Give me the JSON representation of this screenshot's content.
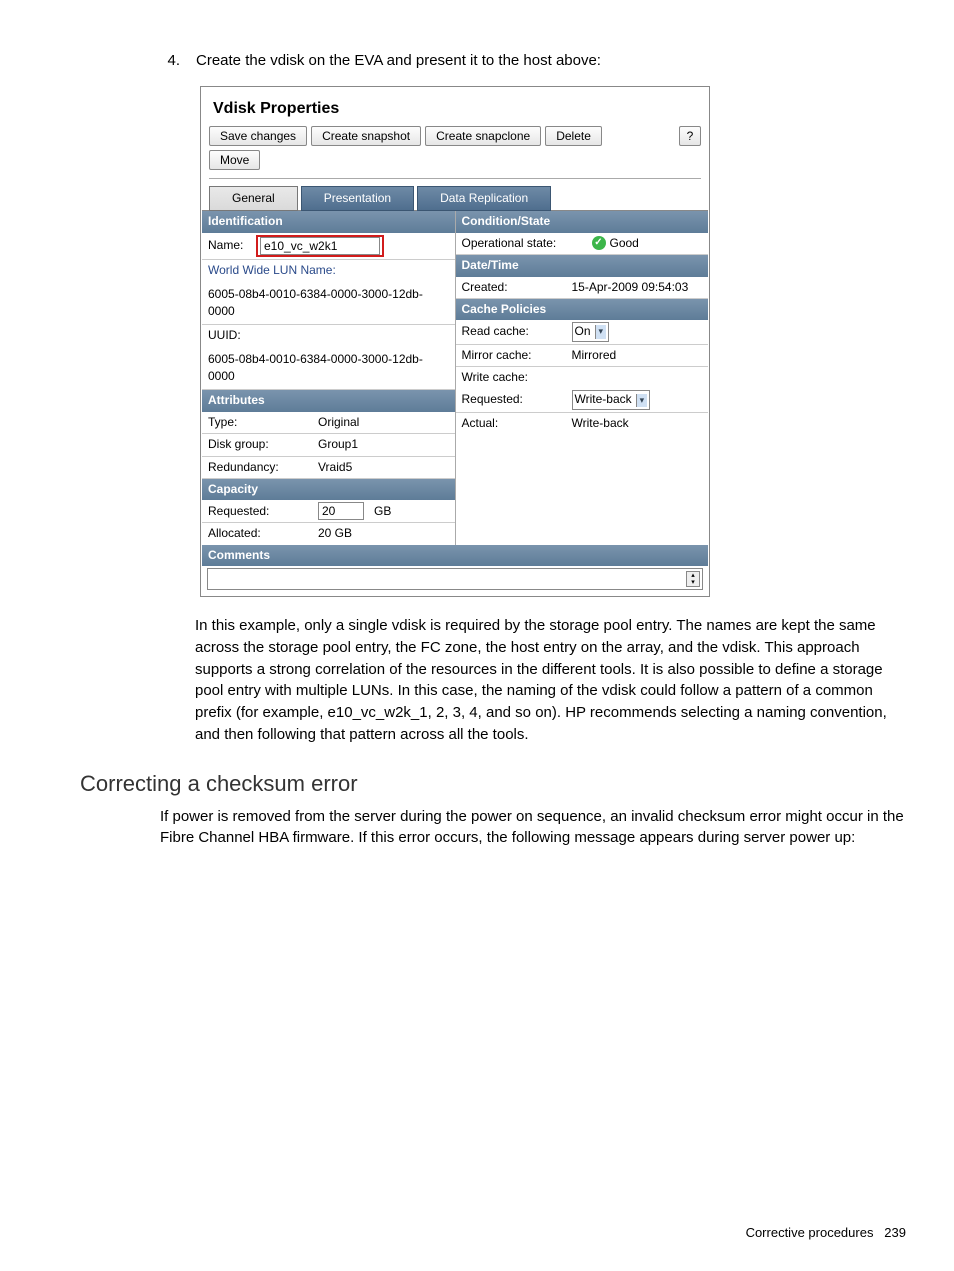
{
  "step": {
    "num": "4.",
    "text": "Create the vdisk on the EVA and present it to the host above:"
  },
  "screenshot": {
    "title": "Vdisk Properties",
    "buttons": {
      "save": "Save changes",
      "snapshot": "Create snapshot",
      "snapclone": "Create snapclone",
      "delete": "Delete",
      "help": "?",
      "move": "Move"
    },
    "tabs": {
      "general": "General",
      "presentation": "Presentation",
      "replication": "Data Replication"
    },
    "left": {
      "identification": {
        "label": "Identification",
        "name_label": "Name:",
        "name_value": "e10_vc_w2k1",
        "wwn_label": "World Wide LUN Name:",
        "wwn_value": "6005-08b4-0010-6384-0000-3000-12db-0000",
        "uuid_label": "UUID:",
        "uuid_value": "6005-08b4-0010-6384-0000-3000-12db-0000"
      },
      "attributes": {
        "label": "Attributes",
        "type_l": "Type:",
        "type_v": "Original",
        "dg_l": "Disk group:",
        "dg_v": "Group1",
        "red_l": "Redundancy:",
        "red_v": "Vraid5"
      },
      "capacity": {
        "label": "Capacity",
        "req_l": "Requested:",
        "req_v": "20",
        "req_u": "GB",
        "alloc_l": "Allocated:",
        "alloc_v": "20 GB"
      },
      "comments": {
        "label": "Comments"
      }
    },
    "right": {
      "cond": {
        "label": "Condition/State",
        "op_l": "Operational state:",
        "op_v": "Good"
      },
      "dt": {
        "label": "Date/Time",
        "cr_l": "Created:",
        "cr_v": "15-Apr-2009 09:54:03"
      },
      "cache": {
        "label": "Cache Policies",
        "read_l": "Read cache:",
        "read_v": "On",
        "mirror_l": "Mirror cache:",
        "mirror_v": "Mirrored",
        "write_l": "Write cache:",
        "req_l": "Requested:",
        "req_v": "Write-back",
        "act_l": "Actual:",
        "act_v": "Write-back"
      }
    }
  },
  "para1": "In this example, only a single vdisk is required by the storage pool entry. The names are kept the same across the storage pool entry, the FC zone, the host entry on the array, and the vdisk. This approach supports a strong correlation of the resources in the different tools. It is also possible to define a storage pool entry with multiple LUNs. In this case, the naming of the vdisk could follow a pattern of a common prefix (for example, e10_vc_w2k_1, 2, 3, 4, and so on). HP recommends selecting a naming convention, and then following that pattern across all the tools.",
  "h2": "Correcting a checksum error",
  "para2": "If power is removed from the server during the power on sequence, an invalid checksum error might occur in the Fibre Channel HBA firmware. If this error occurs, the following message appears during server power up:",
  "footer": {
    "label": "Corrective procedures",
    "page": "239"
  }
}
